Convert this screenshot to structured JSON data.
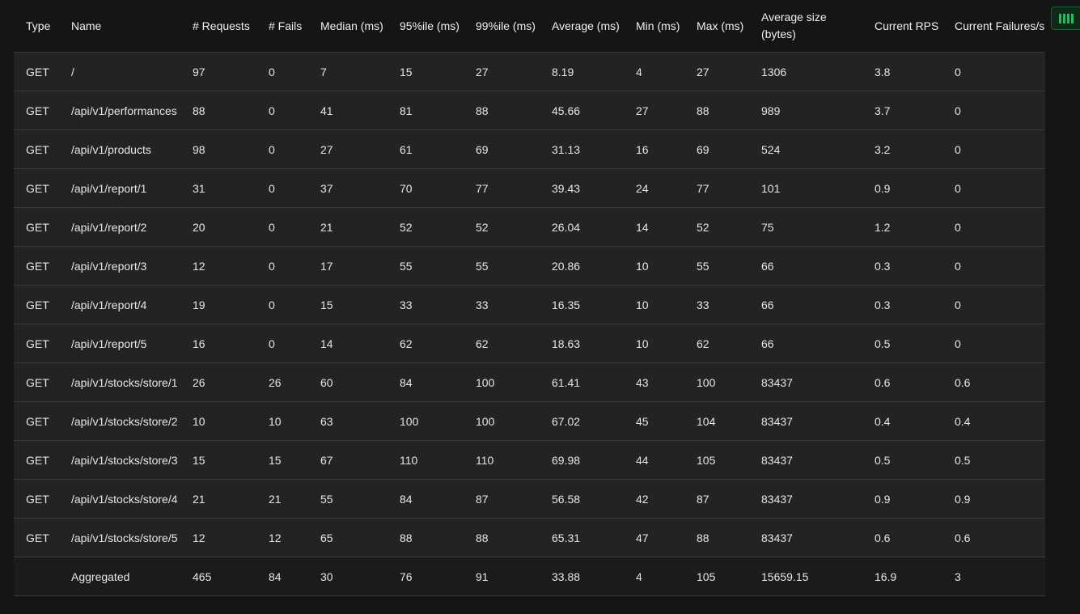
{
  "columns": [
    {
      "key": "type",
      "label": "Type"
    },
    {
      "key": "name",
      "label": "Name"
    },
    {
      "key": "requests",
      "label": "# Requests"
    },
    {
      "key": "fails",
      "label": "# Fails"
    },
    {
      "key": "median",
      "label": "Median (ms)"
    },
    {
      "key": "p95",
      "label": "95%ile (ms)"
    },
    {
      "key": "p99",
      "label": "99%ile (ms)"
    },
    {
      "key": "average",
      "label": "Average (ms)"
    },
    {
      "key": "min",
      "label": "Min (ms)"
    },
    {
      "key": "max",
      "label": "Max (ms)"
    },
    {
      "key": "avg_size",
      "label": "Average size (bytes)"
    },
    {
      "key": "rps",
      "label": "Current RPS"
    },
    {
      "key": "failures_s",
      "label": "Current Failures/s"
    }
  ],
  "rows": [
    [
      "GET",
      "/",
      "97",
      "0",
      "7",
      "15",
      "27",
      "8.19",
      "4",
      "27",
      "1306",
      "3.8",
      "0"
    ],
    [
      "GET",
      "/api/v1/performances",
      "88",
      "0",
      "41",
      "81",
      "88",
      "45.66",
      "27",
      "88",
      "989",
      "3.7",
      "0"
    ],
    [
      "GET",
      "/api/v1/products",
      "98",
      "0",
      "27",
      "61",
      "69",
      "31.13",
      "16",
      "69",
      "524",
      "3.2",
      "0"
    ],
    [
      "GET",
      "/api/v1/report/1",
      "31",
      "0",
      "37",
      "70",
      "77",
      "39.43",
      "24",
      "77",
      "101",
      "0.9",
      "0"
    ],
    [
      "GET",
      "/api/v1/report/2",
      "20",
      "0",
      "21",
      "52",
      "52",
      "26.04",
      "14",
      "52",
      "75",
      "1.2",
      "0"
    ],
    [
      "GET",
      "/api/v1/report/3",
      "12",
      "0",
      "17",
      "55",
      "55",
      "20.86",
      "10",
      "55",
      "66",
      "0.3",
      "0"
    ],
    [
      "GET",
      "/api/v1/report/4",
      "19",
      "0",
      "15",
      "33",
      "33",
      "16.35",
      "10",
      "33",
      "66",
      "0.3",
      "0"
    ],
    [
      "GET",
      "/api/v1/report/5",
      "16",
      "0",
      "14",
      "62",
      "62",
      "18.63",
      "10",
      "62",
      "66",
      "0.5",
      "0"
    ],
    [
      "GET",
      "/api/v1/stocks/store/1",
      "26",
      "26",
      "60",
      "84",
      "100",
      "61.41",
      "43",
      "100",
      "83437",
      "0.6",
      "0.6"
    ],
    [
      "GET",
      "/api/v1/stocks/store/2",
      "10",
      "10",
      "63",
      "100",
      "100",
      "67.02",
      "45",
      "104",
      "83437",
      "0.4",
      "0.4"
    ],
    [
      "GET",
      "/api/v1/stocks/store/3",
      "15",
      "15",
      "67",
      "110",
      "110",
      "69.98",
      "44",
      "105",
      "83437",
      "0.5",
      "0.5"
    ],
    [
      "GET",
      "/api/v1/stocks/store/4",
      "21",
      "21",
      "55",
      "84",
      "87",
      "56.58",
      "42",
      "87",
      "83437",
      "0.9",
      "0.9"
    ],
    [
      "GET",
      "/api/v1/stocks/store/5",
      "12",
      "12",
      "65",
      "88",
      "88",
      "65.31",
      "47",
      "88",
      "83437",
      "0.6",
      "0.6"
    ]
  ],
  "aggregated": [
    "",
    "Aggregated",
    "465",
    "84",
    "30",
    "76",
    "91",
    "33.88",
    "4",
    "105",
    "15659.15",
    "16.9",
    "3"
  ],
  "icons": {
    "corner": "bar-chart-icon"
  },
  "colors": {
    "background": "#151515",
    "row": "#232323",
    "accent": "#1fbf5a"
  }
}
